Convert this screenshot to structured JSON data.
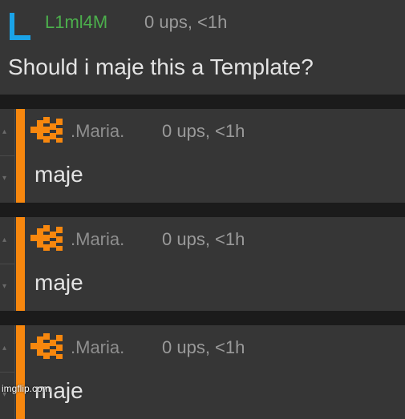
{
  "post": {
    "user": "L1ml4M",
    "meta": "0 ups, <1h",
    "text": "Should i maje this a Template?",
    "avatar_color": "#1aa3e8",
    "user_color": "#4caf4c"
  },
  "replies": [
    {
      "user": ".Maria.",
      "meta": "0 ups, <1h",
      "text": "maje"
    },
    {
      "user": ".Maria.",
      "meta": "0 ups, <1h",
      "text": "maje"
    },
    {
      "user": ".Maria.",
      "meta": "0 ups, <1h",
      "text": "maje"
    }
  ],
  "colors": {
    "reply_bar": "#f7870e",
    "background": "#363636"
  },
  "watermark": "imgflip.com"
}
